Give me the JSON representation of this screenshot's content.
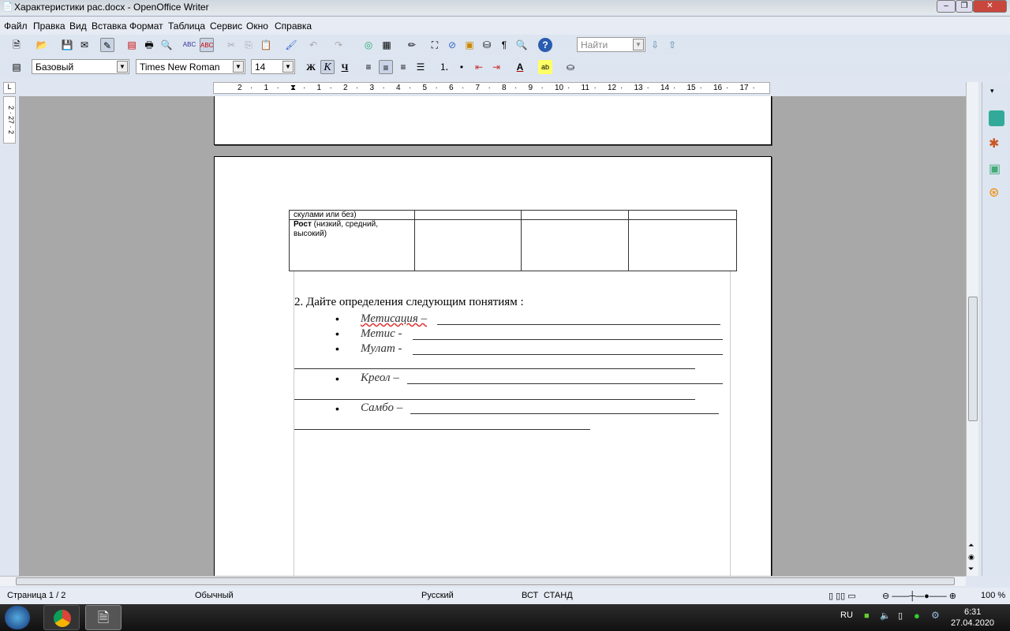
{
  "window": {
    "title": "Характеристики рас.docx - OpenOffice Writer"
  },
  "menu": [
    "Файл",
    "Правка",
    "Вид",
    "Вставка",
    "Формат",
    "Таблица",
    "Сервис",
    "Окно",
    "Справка"
  ],
  "toolbar": {
    "find_placeholder": "Найти"
  },
  "format": {
    "style": "Базовый",
    "font": "Times New Roman",
    "size": "14",
    "bold": "Ж",
    "italic": "К",
    "underline": "Ч"
  },
  "ruler": [
    "2",
    "1",
    "",
    "1",
    "2",
    "3",
    "4",
    "5",
    "6",
    "7",
    "8",
    "9",
    "10",
    "11",
    "12",
    "13",
    "14",
    "15",
    "16",
    "17"
  ],
  "vruler": "2 · 27 · 2",
  "document": {
    "table": {
      "row1": [
        "скулами или без)",
        "",
        "",
        ""
      ],
      "row2_bold": "Рост",
      "row2_rest": " (низкий, средний, высокий)"
    },
    "heading": "2. Дайте определения следующим понятиям :",
    "items": [
      "Метисация –",
      "Метис -",
      "Мулат -",
      "Креол –",
      "Самбо –"
    ]
  },
  "status": {
    "page": "Страница  1 / 2",
    "style": "Обычный",
    "language": "Русский",
    "insert": "ВСТ",
    "selection": "СТАНД",
    "zoom": "100 %"
  },
  "taskbar": {
    "lang": "RU",
    "time": "6:31",
    "date": "27.04.2020"
  }
}
